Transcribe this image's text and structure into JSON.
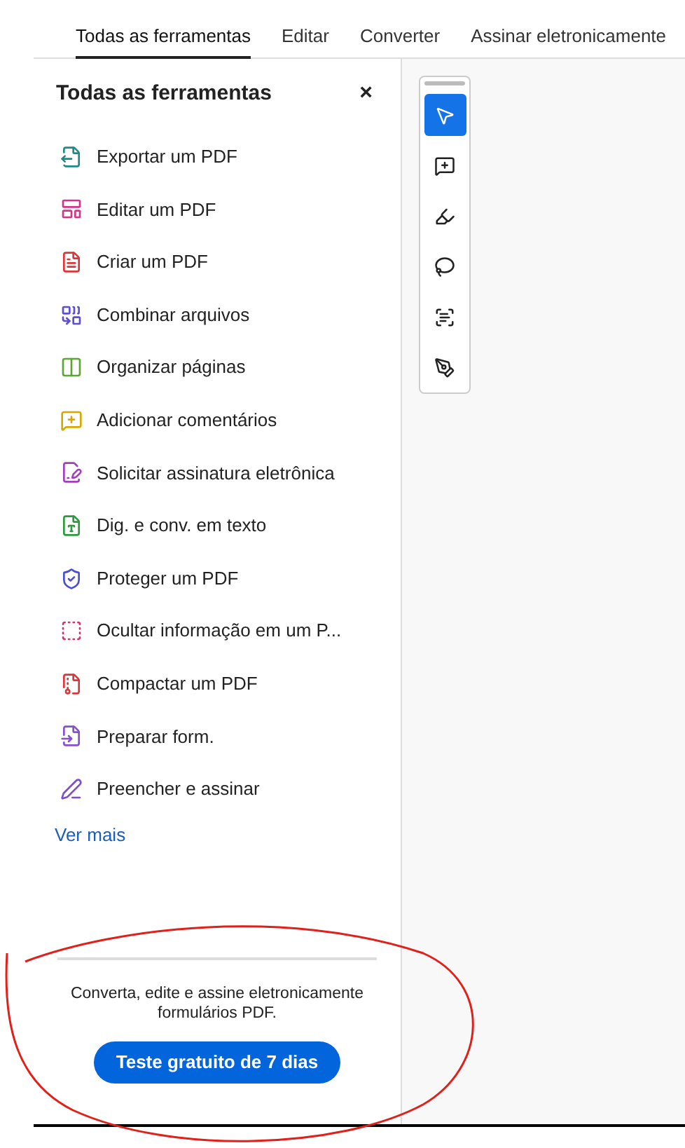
{
  "tabs": [
    {
      "label": "Todas as ferramentas",
      "selected": true
    },
    {
      "label": "Editar",
      "selected": false
    },
    {
      "label": "Converter",
      "selected": false
    },
    {
      "label": "Assinar eletronicamente",
      "selected": false
    }
  ],
  "panel": {
    "title": "Todas as ferramentas",
    "close": "×",
    "items": [
      {
        "label": "Exportar um PDF",
        "color": "#1f8a8a"
      },
      {
        "label": "Editar um PDF",
        "color": "#d6338c"
      },
      {
        "label": "Criar um PDF",
        "color": "#d9383a"
      },
      {
        "label": "Combinar arquivos",
        "color": "#5b4fd6"
      },
      {
        "label": "Organizar páginas",
        "color": "#5aa832"
      },
      {
        "label": "Adicionar comentários",
        "color": "#d9a800"
      },
      {
        "label": "Solicitar assinatura eletrônica",
        "color": "#a33fbf"
      },
      {
        "label": "Dig. e conv. em texto",
        "color": "#2e9a3e"
      },
      {
        "label": "Proteger um PDF",
        "color": "#4a4fd0"
      },
      {
        "label": "Ocultar informação em um P...",
        "color": "#d6336c"
      },
      {
        "label": "Compactar um PDF",
        "color": "#d9383a"
      },
      {
        "label": "Preparar form.",
        "color": "#8a4fd0"
      },
      {
        "label": "Preencher e assinar",
        "color": "#7b4fd0"
      }
    ],
    "more_link": "Ver mais",
    "promo": {
      "text": "Converta, edite e assine eletronicamente formulários PDF.",
      "button": "Teste gratuito de 7 dias"
    }
  },
  "tools": [
    {
      "selected": true
    },
    {
      "selected": false
    },
    {
      "selected": false
    },
    {
      "selected": false
    },
    {
      "selected": false
    },
    {
      "selected": false
    }
  ]
}
